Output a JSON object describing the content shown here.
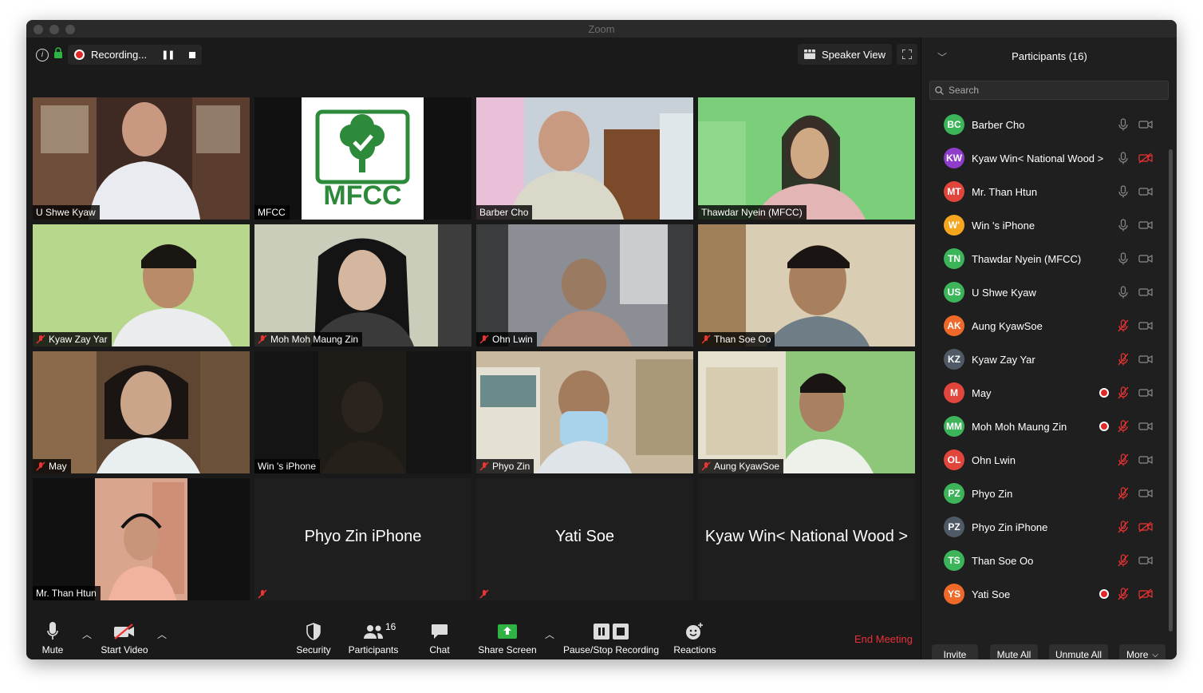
{
  "window": {
    "title": "Zoom"
  },
  "recording": {
    "label": "Recording..."
  },
  "view": {
    "speaker_view_label": "Speaker View"
  },
  "tiles": [
    {
      "name": "U Shwe Kyaw",
      "muted": false
    },
    {
      "name": "MFCC",
      "muted": false,
      "logo_text": "MFCC"
    },
    {
      "name": "Barber Cho",
      "muted": false,
      "active": true
    },
    {
      "name": "Thawdar Nyein (MFCC)",
      "muted": false
    },
    {
      "name": "Kyaw Zay Yar",
      "muted": true
    },
    {
      "name": "Moh Moh Maung Zin",
      "muted": true
    },
    {
      "name": "Ohn Lwin",
      "muted": true
    },
    {
      "name": "Than Soe Oo",
      "muted": true
    },
    {
      "name": "May",
      "muted": true
    },
    {
      "name": "Win 's iPhone",
      "muted": false
    },
    {
      "name": "Phyo Zin",
      "muted": true
    },
    {
      "name": "Aung KyawSoe",
      "muted": true
    },
    {
      "name": "Mr. Than Htun",
      "muted": false
    },
    {
      "big_name": "Phyo Zin iPhone",
      "muted": true
    },
    {
      "big_name": "Yati Soe",
      "muted": true
    },
    {
      "big_name": "Kyaw Win< National Wood >",
      "muted": false
    }
  ],
  "sidebar": {
    "title": "Participants (16)",
    "search_placeholder": "Search",
    "participants": [
      {
        "initials": "BC",
        "name": "Barber Cho",
        "color": "#3cb55a",
        "mic_muted": false,
        "video_off": false,
        "recording": false
      },
      {
        "initials": "KW",
        "name": "Kyaw Win< National Wood >",
        "color": "#8e3cc9",
        "mic_muted": false,
        "video_off": true,
        "recording": false
      },
      {
        "initials": "MT",
        "name": "Mr. Than Htun",
        "color": "#e0463c",
        "mic_muted": false,
        "video_off": false,
        "recording": false
      },
      {
        "initials": "W'",
        "name": "Win 's iPhone",
        "color": "#f5a61e",
        "mic_muted": false,
        "video_off": false,
        "recording": false
      },
      {
        "initials": "TN",
        "name": "Thawdar Nyein (MFCC)",
        "color": "#3cb55a",
        "mic_muted": false,
        "video_off": false,
        "recording": false
      },
      {
        "initials": "US",
        "name": "U Shwe Kyaw",
        "color": "#3cb55a",
        "mic_muted": false,
        "video_off": false,
        "recording": false
      },
      {
        "initials": "AK",
        "name": "Aung KyawSoe",
        "color": "#ef6a2a",
        "mic_muted": true,
        "video_off": false,
        "recording": false
      },
      {
        "initials": "KZ",
        "name": "Kyaw Zay Yar",
        "color": "#505a66",
        "mic_muted": true,
        "video_off": false,
        "recording": false
      },
      {
        "initials": "M",
        "name": "May",
        "color": "#e0463c",
        "mic_muted": true,
        "video_off": false,
        "recording": true
      },
      {
        "initials": "MM",
        "name": "Moh Moh Maung Zin",
        "color": "#3cb55a",
        "mic_muted": true,
        "video_off": false,
        "recording": true
      },
      {
        "initials": "OL",
        "name": "Ohn Lwin",
        "color": "#e0463c",
        "mic_muted": true,
        "video_off": false,
        "recording": false
      },
      {
        "initials": "PZ",
        "name": "Phyo Zin",
        "color": "#3cb55a",
        "mic_muted": true,
        "video_off": false,
        "recording": false
      },
      {
        "initials": "PZ",
        "name": "Phyo Zin iPhone",
        "color": "#505a66",
        "mic_muted": true,
        "video_off": true,
        "recording": false
      },
      {
        "initials": "TS",
        "name": "Than Soe Oo",
        "color": "#3cb55a",
        "mic_muted": true,
        "video_off": false,
        "recording": false
      },
      {
        "initials": "YS",
        "name": "Yati Soe",
        "color": "#ef6a2a",
        "mic_muted": true,
        "video_off": true,
        "recording": true
      }
    ],
    "buttons": {
      "invite": "Invite",
      "mute_all": "Mute All",
      "unmute_all": "Unmute All",
      "more": "More"
    }
  },
  "toolbar": {
    "mute": "Mute",
    "start_video": "Start Video",
    "security": "Security",
    "participants": "Participants",
    "participants_count": "16",
    "chat": "Chat",
    "share_screen": "Share Screen",
    "pause_stop_recording": "Pause/Stop Recording",
    "reactions": "Reactions",
    "end_meeting": "End Meeting"
  }
}
